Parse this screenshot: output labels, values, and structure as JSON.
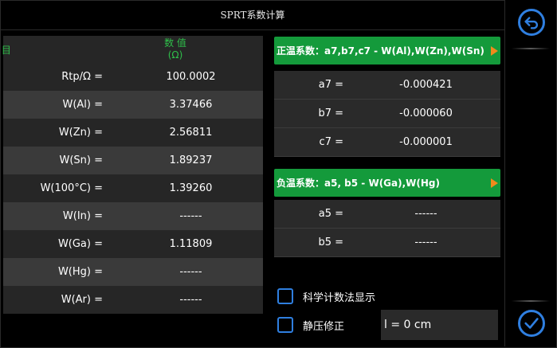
{
  "window": {
    "title": "SPRT系数计算"
  },
  "table": {
    "header_item": "项 目",
    "header_value_line1": "数 值",
    "header_value_line2": "(Ω)",
    "rows": [
      {
        "label": "Rtp/Ω =",
        "value": "100.0002"
      },
      {
        "label": "W(Al) =",
        "value": "3.37466"
      },
      {
        "label": "W(Zn) =",
        "value": "2.56811"
      },
      {
        "label": "W(Sn) =",
        "value": "1.89237"
      },
      {
        "label": "W(100°C) =",
        "value": "1.39260"
      },
      {
        "label": "W(In) =",
        "value": "------"
      },
      {
        "label": "W(Ga) =",
        "value": "1.11809"
      },
      {
        "label": "W(Hg) =",
        "value": "------"
      },
      {
        "label": "W(Ar) =",
        "value": "------"
      }
    ]
  },
  "positive": {
    "button_label": "正温系数：a7,b7,c7 - W(Al),W(Zn),W(Sn)",
    "rows": [
      {
        "label": "a7 =",
        "value": "-0.000421"
      },
      {
        "label": "b7 =",
        "value": "-0.000060"
      },
      {
        "label": "c7 =",
        "value": "-0.000001"
      }
    ]
  },
  "negative": {
    "button_label": "负温系数：a5, b5 - W(Ga),W(Hg)",
    "rows": [
      {
        "label": "a5 =",
        "value": "------"
      },
      {
        "label": "b5 =",
        "value": "------"
      }
    ]
  },
  "options": {
    "scientific_label": "科学计数法显示",
    "static_pressure_label": "静压修正",
    "length_value": "l = 0 cm"
  },
  "icons": {
    "back": "back-arrow-icon",
    "confirm": "checkmark-icon"
  },
  "colors": {
    "accent_green": "#149a3b",
    "accent_blue": "#2f7fe0",
    "arrow_orange": "#f08a1c",
    "header_green": "#2fbf4a"
  }
}
